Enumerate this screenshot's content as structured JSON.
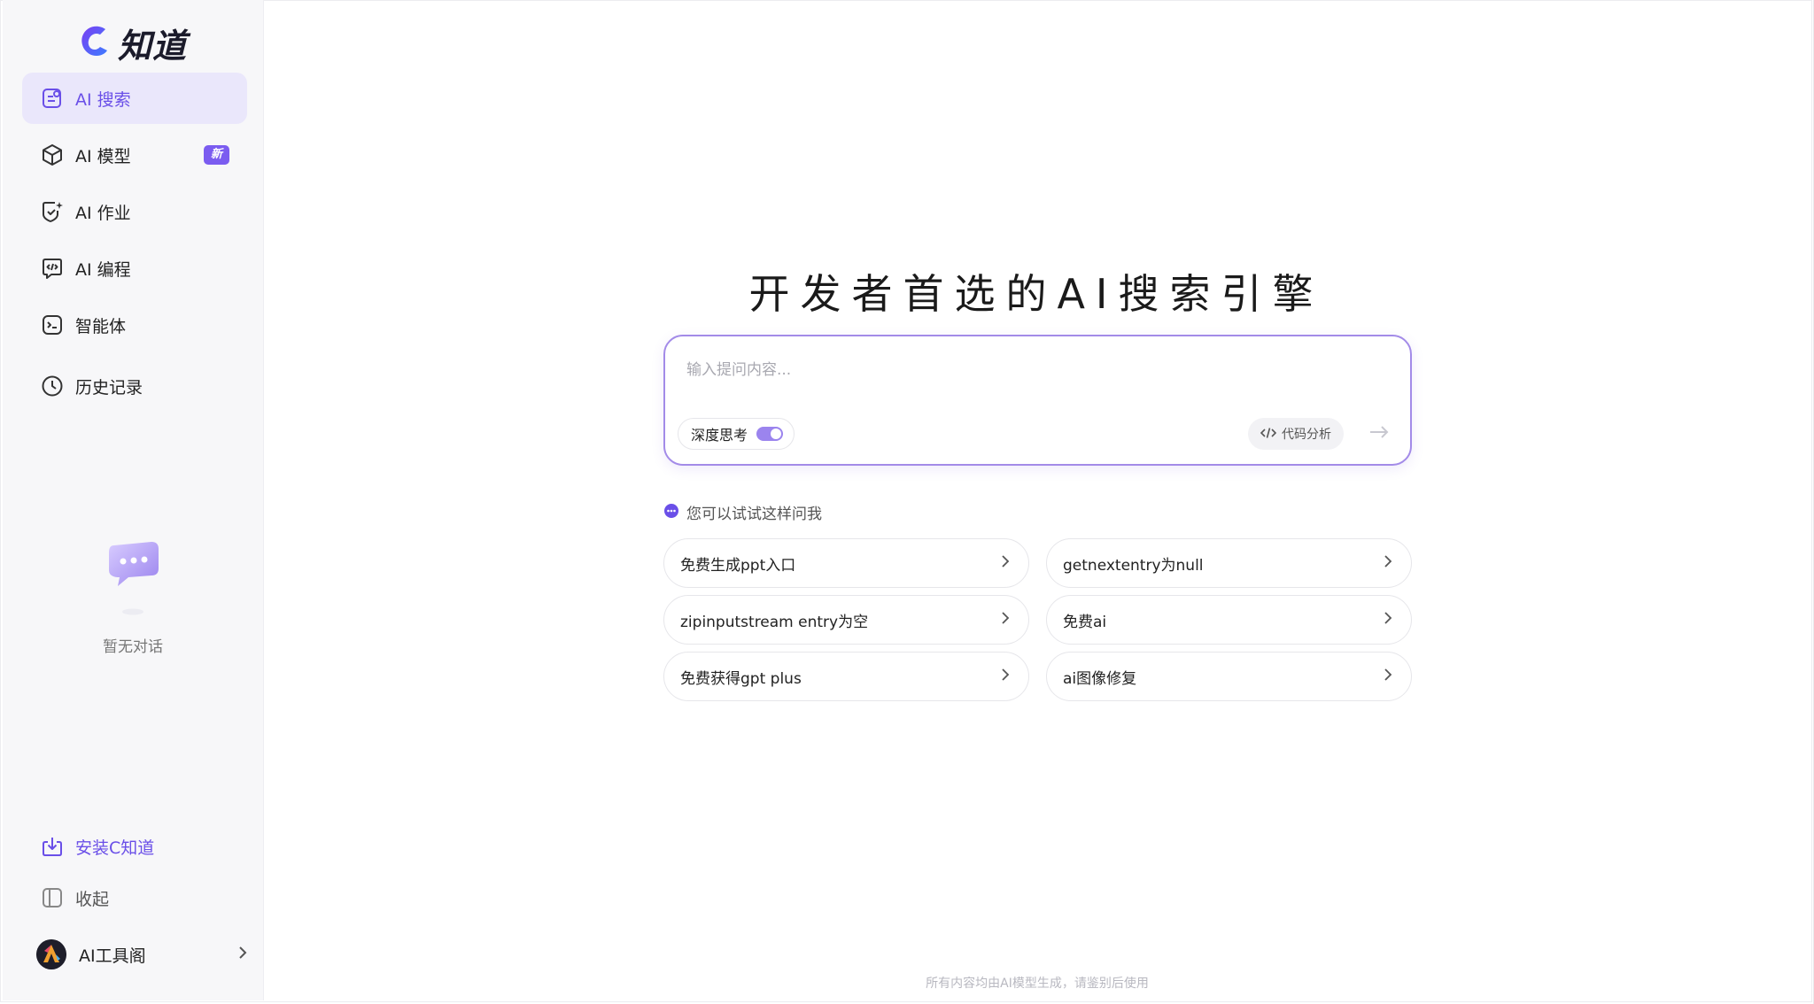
{
  "colors": {
    "accent": "#6a4fe8",
    "active_bg": "#eae7fb",
    "badge": "#7b5cf0"
  },
  "sidebar": {
    "logo_text": "知道",
    "items": [
      {
        "label": "AI 搜索",
        "icon": "search-doc-icon",
        "active": true
      },
      {
        "label": "AI 模型",
        "icon": "cube-icon",
        "badge": "新"
      },
      {
        "label": "AI 作业",
        "icon": "shield-star-icon"
      },
      {
        "label": "AI 编程",
        "icon": "code-chat-icon"
      },
      {
        "label": "智能体",
        "icon": "terminal-icon"
      },
      {
        "label": "历史记录",
        "icon": "clock-icon"
      }
    ],
    "empty_text": "暂无对话",
    "install_label": "安装C知道",
    "collapse_label": "收起",
    "user_name": "AI工具阁"
  },
  "main": {
    "headline": "开发者首选的AI搜索引擎",
    "search": {
      "placeholder": "输入提问内容...",
      "deep_think_label": "深度思考",
      "deep_think_on": true,
      "code_label": "代码分析"
    },
    "suggest_title": "您可以试试这样问我",
    "suggestions": [
      "免费生成ppt入口",
      "getnextentry为null",
      "zipinputstream entry为空",
      "免费ai",
      "免费获得gpt plus",
      "ai图像修复"
    ],
    "footer_note": "所有内容均由AI模型生成，请鉴别后使用"
  }
}
